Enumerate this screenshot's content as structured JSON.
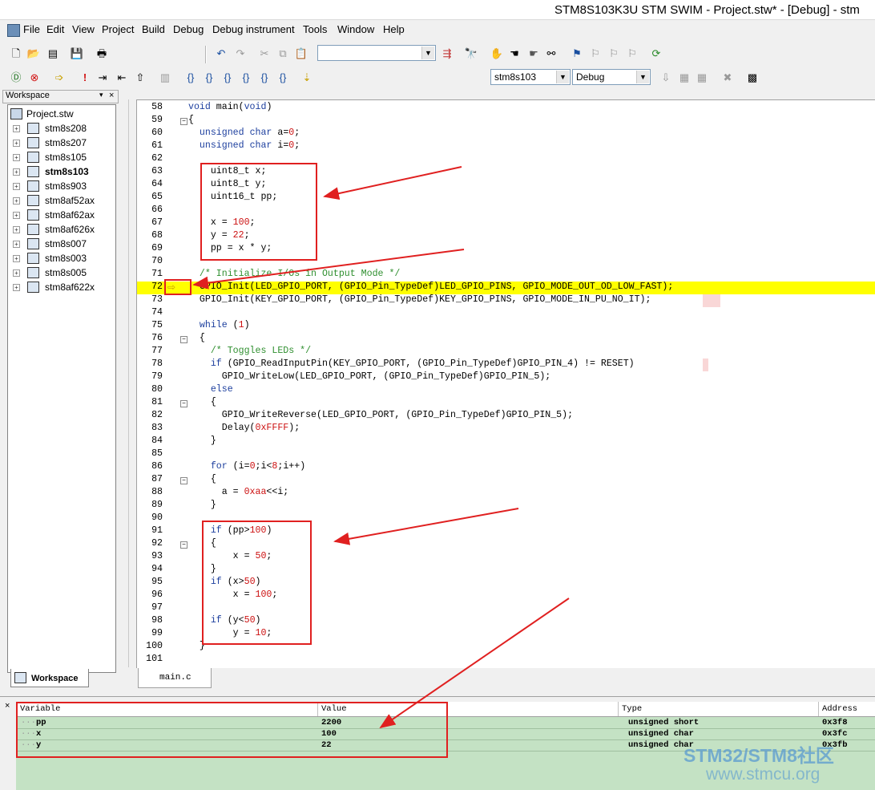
{
  "window": {
    "title": "STM8S103K3U STM SWIM - Project.stw* - [Debug] - stm"
  },
  "menu": [
    "File",
    "Edit",
    "View",
    "Project",
    "Build",
    "Debug",
    "Debug instrument",
    "Tools",
    "Window",
    "Help"
  ],
  "toolbar": {
    "search_combo_value": "",
    "target_combo_value": "stm8s103",
    "config_combo_value": "Debug"
  },
  "workspace": {
    "title": "Workspace",
    "root": "Project.stw",
    "items": [
      "stm8s208",
      "stm8s207",
      "stm8s105",
      "stm8s103",
      "stm8s903",
      "stm8af52ax",
      "stm8af62ax",
      "stm8af626x",
      "stm8s007",
      "stm8s003",
      "stm8s005",
      "stm8af622x"
    ],
    "active_item": "stm8s103",
    "tab_label": "Workspace"
  },
  "editor": {
    "file_tab": "main.c",
    "current_line": 72,
    "lines": [
      {
        "n": "58",
        "t": "void main(void)"
      },
      {
        "n": "59",
        "t": "{"
      },
      {
        "n": "60",
        "t": "  unsigned char a=0;"
      },
      {
        "n": "61",
        "t": "  unsigned char i=0;"
      },
      {
        "n": "62",
        "t": ""
      },
      {
        "n": "63",
        "t": "    uint8_t x;"
      },
      {
        "n": "64",
        "t": "    uint8_t y;"
      },
      {
        "n": "65",
        "t": "    uint16_t pp;"
      },
      {
        "n": "66",
        "t": ""
      },
      {
        "n": "67",
        "t": "    x = 100;"
      },
      {
        "n": "68",
        "t": "    y = 22;"
      },
      {
        "n": "69",
        "t": "    pp = x * y;"
      },
      {
        "n": "70",
        "t": ""
      },
      {
        "n": "71",
        "t": "  /* Initialize I/Os in Output Mode */"
      },
      {
        "n": "72",
        "t": "  GPIO_Init(LED_GPIO_PORT, (GPIO_Pin_TypeDef)LED_GPIO_PINS, GPIO_MODE_OUT_OD_LOW_FAST);"
      },
      {
        "n": "73",
        "t": "  GPIO_Init(KEY_GPIO_PORT, (GPIO_Pin_TypeDef)KEY_GPIO_PINS, GPIO_MODE_IN_PU_NO_IT);"
      },
      {
        "n": "74",
        "t": ""
      },
      {
        "n": "75",
        "t": "  while (1)"
      },
      {
        "n": "76",
        "t": "  {"
      },
      {
        "n": "77",
        "t": "    /* Toggles LEDs */"
      },
      {
        "n": "78",
        "t": "    if (GPIO_ReadInputPin(KEY_GPIO_PORT, (GPIO_Pin_TypeDef)GPIO_PIN_4) != RESET)"
      },
      {
        "n": "79",
        "t": "      GPIO_WriteLow(LED_GPIO_PORT, (GPIO_Pin_TypeDef)GPIO_PIN_5);"
      },
      {
        "n": "80",
        "t": "    else"
      },
      {
        "n": "81",
        "t": "    {"
      },
      {
        "n": "82",
        "t": "      GPIO_WriteReverse(LED_GPIO_PORT, (GPIO_Pin_TypeDef)GPIO_PIN_5);"
      },
      {
        "n": "83",
        "t": "      Delay(0xFFFF);"
      },
      {
        "n": "84",
        "t": "    }"
      },
      {
        "n": "85",
        "t": ""
      },
      {
        "n": "86",
        "t": "    for (i=0;i<8;i++)"
      },
      {
        "n": "87",
        "t": "    {"
      },
      {
        "n": "88",
        "t": "      a = 0xaa<<i;"
      },
      {
        "n": "89",
        "t": "    }"
      },
      {
        "n": "90",
        "t": ""
      },
      {
        "n": "91",
        "t": "    if (pp>100)"
      },
      {
        "n": "92",
        "t": "    {"
      },
      {
        "n": "93",
        "t": "        x = 50;"
      },
      {
        "n": "94",
        "t": "    }"
      },
      {
        "n": "95",
        "t": "    if (x>50)"
      },
      {
        "n": "96",
        "t": "        x = 100;"
      },
      {
        "n": "97",
        "t": ""
      },
      {
        "n": "98",
        "t": "    if (y<50)"
      },
      {
        "n": "99",
        "t": "        y = 10;"
      },
      {
        "n": "100",
        "t": "  }"
      },
      {
        "n": "101",
        "t": ""
      }
    ]
  },
  "variables": {
    "headers": [
      "Variable",
      "Value",
      "Type",
      "Address"
    ],
    "rows": [
      {
        "name": "pp",
        "value": "2200",
        "type": "unsigned short",
        "address": "0x3f8"
      },
      {
        "name": "x",
        "value": "100",
        "type": "unsigned char",
        "address": "0x3fc"
      },
      {
        "name": "y",
        "value": "22",
        "type": "unsigned char",
        "address": "0x3fb"
      }
    ]
  },
  "watermark": {
    "line1": "STM32/STM8社区",
    "line2": "www.stmcu.org"
  },
  "colors": {
    "current_line": "#ffff00",
    "annotation": "#e02020",
    "keyword": "#1d3f9e",
    "number": "#cc1111",
    "comment": "#2f8f2f",
    "watch_bg": "#c4e2c4"
  }
}
